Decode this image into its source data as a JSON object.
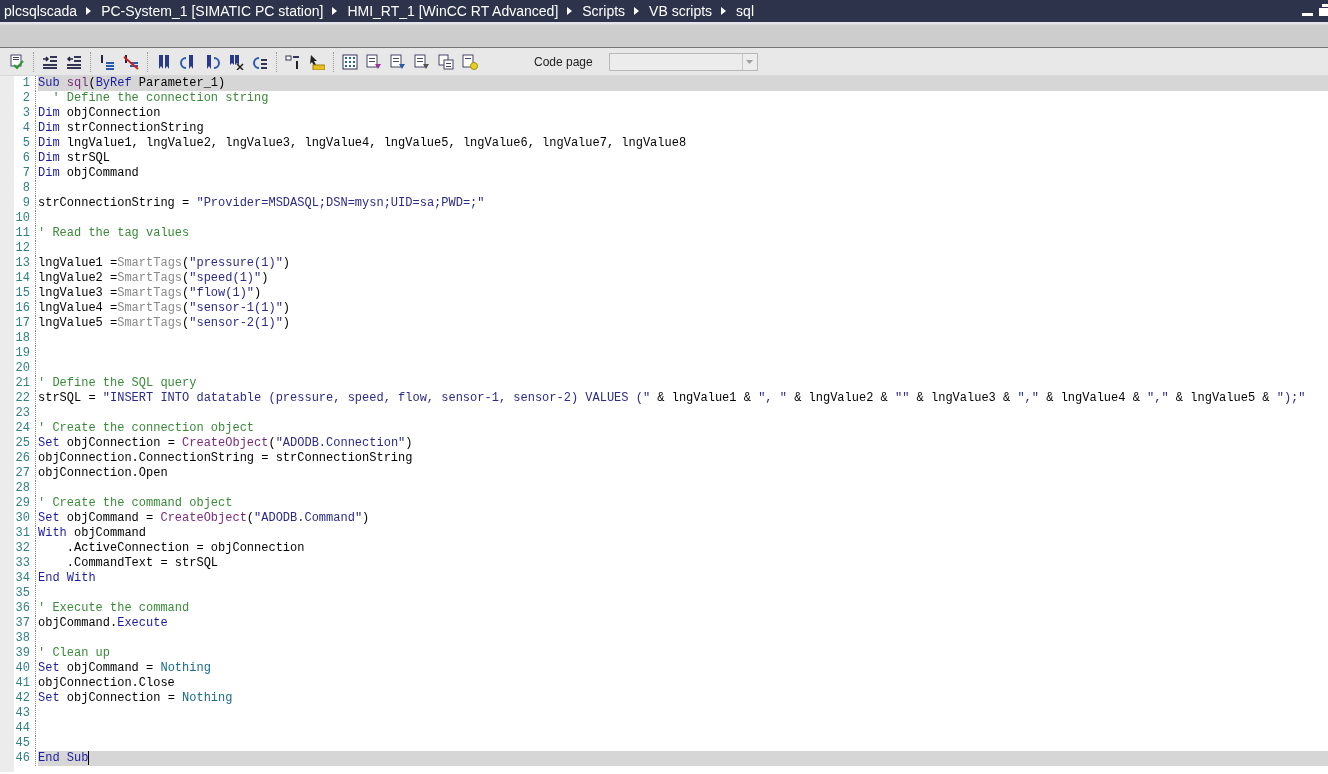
{
  "breadcrumb": [
    "plcsqlscada",
    "PC-System_1 [SIMATIC PC station]",
    "HMI_RT_1 [WinCC RT Advanced]",
    "Scripts",
    "VB scripts",
    "sql"
  ],
  "toolbar": {
    "code_page": {
      "label": "Code page",
      "disabled": true
    }
  },
  "editor": {
    "lines": [
      {
        "number": "1",
        "highlighted": true,
        "caret": false,
        "tokens": [
          {
            "kind": "keyword",
            "text": "Sub"
          },
          {
            "kind": "function",
            "text": " sql"
          },
          {
            "kind": "plain",
            "text": "("
          },
          {
            "kind": "keyword",
            "text": "ByRef"
          },
          {
            "kind": "plain",
            "text": " Parameter_1)"
          }
        ]
      },
      {
        "number": "2",
        "highlighted": false,
        "caret": false,
        "tokens": [
          {
            "kind": "comment",
            "text": "  ' Define the connection string"
          }
        ]
      },
      {
        "number": "3",
        "highlighted": false,
        "caret": false,
        "tokens": [
          {
            "kind": "keyword",
            "text": "Dim"
          },
          {
            "kind": "plain",
            "text": " objConnection"
          }
        ]
      },
      {
        "number": "4",
        "highlighted": false,
        "caret": false,
        "tokens": [
          {
            "kind": "keyword",
            "text": "Dim"
          },
          {
            "kind": "plain",
            "text": " strConnectionString"
          }
        ]
      },
      {
        "number": "5",
        "highlighted": false,
        "caret": false,
        "tokens": [
          {
            "kind": "keyword",
            "text": "Dim"
          },
          {
            "kind": "plain",
            "text": " lngValue1, lngValue2, lngValue3, lngValue4, lngValue5, lngValue6, lngValue7, lngValue8"
          }
        ]
      },
      {
        "number": "6",
        "highlighted": false,
        "caret": false,
        "tokens": [
          {
            "kind": "keyword",
            "text": "Dim"
          },
          {
            "kind": "plain",
            "text": " strSQL"
          }
        ]
      },
      {
        "number": "7",
        "highlighted": false,
        "caret": false,
        "tokens": [
          {
            "kind": "keyword",
            "text": "Dim"
          },
          {
            "kind": "plain",
            "text": " objCommand"
          }
        ]
      },
      {
        "number": "8",
        "highlighted": false,
        "caret": false
      },
      {
        "number": "9",
        "highlighted": false,
        "caret": false,
        "tokens": [
          {
            "kind": "plain",
            "text": "strConnectionString = "
          },
          {
            "kind": "string",
            "text": "\"Provider=MSDASQL;DSN=mysn;UID=sa;PWD=;\""
          }
        ]
      },
      {
        "number": "10",
        "highlighted": false,
        "caret": false
      },
      {
        "number": "11",
        "highlighted": false,
        "caret": false,
        "tokens": [
          {
            "kind": "comment",
            "text": "' Read the tag values"
          }
        ]
      },
      {
        "number": "12",
        "highlighted": false,
        "caret": false
      },
      {
        "number": "13",
        "highlighted": false,
        "caret": false,
        "tokens": [
          {
            "kind": "plain",
            "text": "lngValue1 ="
          },
          {
            "kind": "builtin",
            "text": "SmartTags"
          },
          {
            "kind": "plain",
            "text": "("
          },
          {
            "kind": "string",
            "text": "\"pressure(1)\""
          },
          {
            "kind": "plain",
            "text": ")"
          }
        ]
      },
      {
        "number": "14",
        "highlighted": false,
        "caret": false,
        "tokens": [
          {
            "kind": "plain",
            "text": "lngValue2 ="
          },
          {
            "kind": "builtin",
            "text": "SmartTags"
          },
          {
            "kind": "plain",
            "text": "("
          },
          {
            "kind": "string",
            "text": "\"speed(1)\""
          },
          {
            "kind": "plain",
            "text": ")"
          }
        ]
      },
      {
        "number": "15",
        "highlighted": false,
        "caret": false,
        "tokens": [
          {
            "kind": "plain",
            "text": "lngValue3 ="
          },
          {
            "kind": "builtin",
            "text": "SmartTags"
          },
          {
            "kind": "plain",
            "text": "("
          },
          {
            "kind": "string",
            "text": "\"flow(1)\""
          },
          {
            "kind": "plain",
            "text": ")"
          }
        ]
      },
      {
        "number": "16",
        "highlighted": false,
        "caret": false,
        "tokens": [
          {
            "kind": "plain",
            "text": "lngValue4 ="
          },
          {
            "kind": "builtin",
            "text": "SmartTags"
          },
          {
            "kind": "plain",
            "text": "("
          },
          {
            "kind": "string",
            "text": "\"sensor-1(1)\""
          },
          {
            "kind": "plain",
            "text": ")"
          }
        ]
      },
      {
        "number": "17",
        "highlighted": false,
        "caret": false,
        "tokens": [
          {
            "kind": "plain",
            "text": "lngValue5 ="
          },
          {
            "kind": "builtin",
            "text": "SmartTags"
          },
          {
            "kind": "plain",
            "text": "("
          },
          {
            "kind": "string",
            "text": "\"sensor-2(1)\""
          },
          {
            "kind": "plain",
            "text": ")"
          }
        ]
      },
      {
        "number": "18",
        "highlighted": false,
        "caret": false
      },
      {
        "number": "19",
        "highlighted": false,
        "caret": false
      },
      {
        "number": "20",
        "highlighted": false,
        "caret": false
      },
      {
        "number": "21",
        "highlighted": false,
        "caret": false,
        "tokens": [
          {
            "kind": "comment",
            "text": "' Define the SQL query"
          }
        ]
      },
      {
        "number": "22",
        "highlighted": false,
        "caret": false,
        "tokens": [
          {
            "kind": "plain",
            "text": "strSQL = "
          },
          {
            "kind": "string",
            "text": "\"INSERT INTO datatable (pressure, speed, flow, sensor-1, sensor-2) VALUES (\""
          },
          {
            "kind": "plain",
            "text": " & lngValue1 & "
          },
          {
            "kind": "string",
            "text": "\", \""
          },
          {
            "kind": "plain",
            "text": " & lngValue2 & "
          },
          {
            "kind": "string",
            "text": "\"\""
          },
          {
            "kind": "plain",
            "text": " & lngValue3 & "
          },
          {
            "kind": "string",
            "text": "\",\""
          },
          {
            "kind": "plain",
            "text": " & lngValue4 & "
          },
          {
            "kind": "string",
            "text": "\",\""
          },
          {
            "kind": "plain",
            "text": " & lngValue5 & "
          },
          {
            "kind": "string",
            "text": "\");\""
          }
        ]
      },
      {
        "number": "23",
        "highlighted": false,
        "caret": false
      },
      {
        "number": "24",
        "highlighted": false,
        "caret": false,
        "tokens": [
          {
            "kind": "comment",
            "text": "' Create the connection object"
          }
        ]
      },
      {
        "number": "25",
        "highlighted": false,
        "caret": false,
        "tokens": [
          {
            "kind": "keyword",
            "text": "Set"
          },
          {
            "kind": "plain",
            "text": " objConnection = "
          },
          {
            "kind": "function",
            "text": "CreateObject"
          },
          {
            "kind": "plain",
            "text": "("
          },
          {
            "kind": "string",
            "text": "\"ADODB.Connection\""
          },
          {
            "kind": "plain",
            "text": ")"
          }
        ]
      },
      {
        "number": "26",
        "highlighted": false,
        "caret": false,
        "tokens": [
          {
            "kind": "plain",
            "text": "objConnection.ConnectionString = strConnectionString"
          }
        ]
      },
      {
        "number": "27",
        "highlighted": false,
        "caret": false,
        "tokens": [
          {
            "kind": "plain",
            "text": "objConnection.Open"
          }
        ]
      },
      {
        "number": "28",
        "highlighted": false,
        "caret": false
      },
      {
        "number": "29",
        "highlighted": false,
        "caret": false,
        "tokens": [
          {
            "kind": "comment",
            "text": "' Create the command object"
          }
        ]
      },
      {
        "number": "30",
        "highlighted": false,
        "caret": false,
        "tokens": [
          {
            "kind": "keyword",
            "text": "Set"
          },
          {
            "kind": "plain",
            "text": " objCommand = "
          },
          {
            "kind": "function",
            "text": "CreateObject"
          },
          {
            "kind": "plain",
            "text": "("
          },
          {
            "kind": "string",
            "text": "\"ADODB.Command\""
          },
          {
            "kind": "plain",
            "text": ")"
          }
        ]
      },
      {
        "number": "31",
        "highlighted": false,
        "caret": false,
        "tokens": [
          {
            "kind": "keyword",
            "text": "With"
          },
          {
            "kind": "plain",
            "text": " objCommand"
          }
        ]
      },
      {
        "number": "32",
        "highlighted": false,
        "caret": false,
        "tokens": [
          {
            "kind": "plain",
            "text": "    .ActiveConnection = objConnection"
          }
        ]
      },
      {
        "number": "33",
        "highlighted": false,
        "caret": false,
        "tokens": [
          {
            "kind": "plain",
            "text": "    .CommandText = strSQL"
          }
        ]
      },
      {
        "number": "34",
        "highlighted": false,
        "caret": false,
        "tokens": [
          {
            "kind": "keyword",
            "text": "End With"
          }
        ]
      },
      {
        "number": "35",
        "highlighted": false,
        "caret": false
      },
      {
        "number": "36",
        "highlighted": false,
        "caret": false,
        "tokens": [
          {
            "kind": "comment",
            "text": "' Execute the command"
          }
        ]
      },
      {
        "number": "37",
        "highlighted": false,
        "caret": false,
        "tokens": [
          {
            "kind": "plain",
            "text": "objCommand."
          },
          {
            "kind": "keyword",
            "text": "Execute"
          }
        ]
      },
      {
        "number": "38",
        "highlighted": false,
        "caret": false
      },
      {
        "number": "39",
        "highlighted": false,
        "caret": false,
        "tokens": [
          {
            "kind": "comment",
            "text": "' Clean up"
          }
        ]
      },
      {
        "number": "40",
        "highlighted": false,
        "caret": false,
        "tokens": [
          {
            "kind": "keyword",
            "text": "Set"
          },
          {
            "kind": "plain",
            "text": " objCommand = "
          },
          {
            "kind": "constant",
            "text": "Nothing"
          }
        ]
      },
      {
        "number": "41",
        "highlighted": false,
        "caret": false,
        "tokens": [
          {
            "kind": "plain",
            "text": "objConnection.Close"
          }
        ]
      },
      {
        "number": "42",
        "highlighted": false,
        "caret": false,
        "tokens": [
          {
            "kind": "keyword",
            "text": "Set"
          },
          {
            "kind": "plain",
            "text": " objConnection = "
          },
          {
            "kind": "constant",
            "text": "Nothing"
          }
        ]
      },
      {
        "number": "43",
        "highlighted": false,
        "caret": false
      },
      {
        "number": "44",
        "highlighted": false,
        "caret": false
      },
      {
        "number": "45",
        "highlighted": false,
        "caret": false
      },
      {
        "number": "46",
        "highlighted": true,
        "caret": true,
        "tokens": [
          {
            "kind": "keyword",
            "text": "End Sub"
          }
        ]
      }
    ]
  }
}
